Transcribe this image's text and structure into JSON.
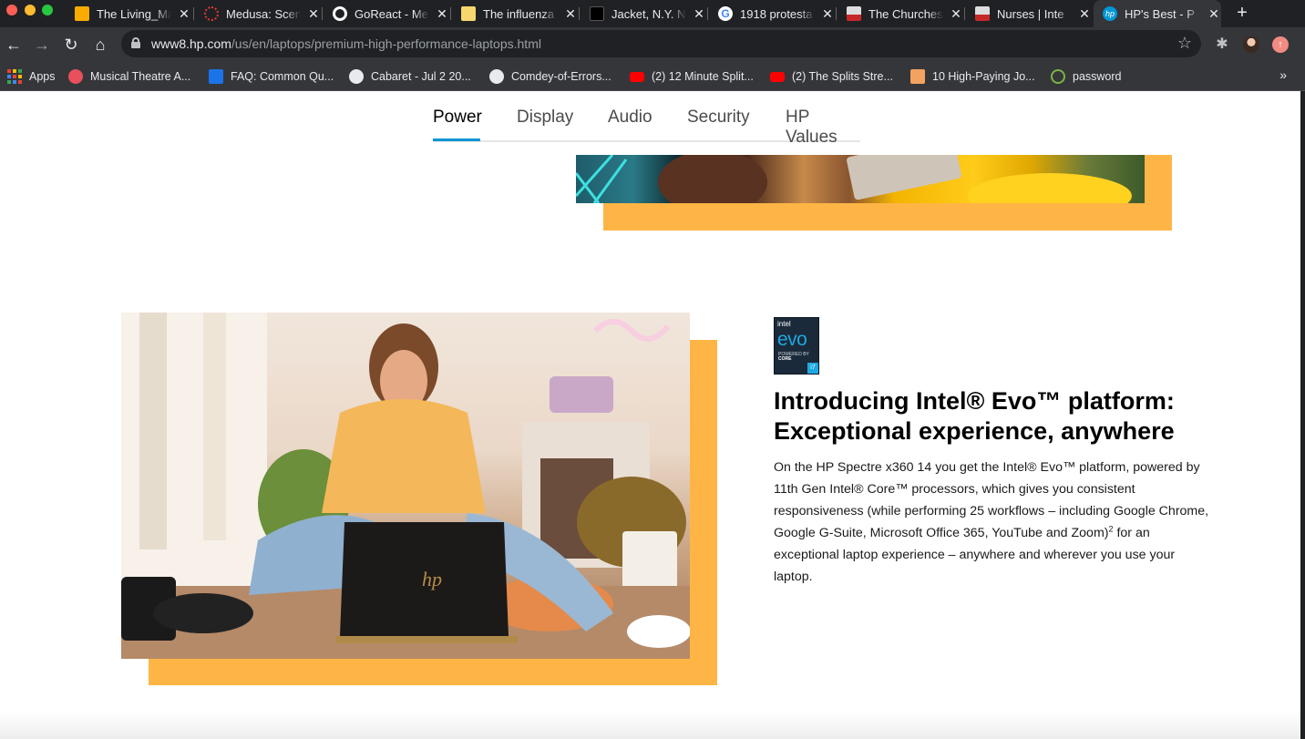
{
  "browser": {
    "tabs": [
      {
        "title": "The Living_Ma",
        "icon": "slides-icon",
        "color": "#f9ab00"
      },
      {
        "title": "Medusa: Scen",
        "icon": "medusa-icon",
        "color": "#e53935"
      },
      {
        "title": "GoReact - Me",
        "icon": "goreact-icon",
        "color": "#ffffff"
      },
      {
        "title": "The influenza",
        "icon": "influenza-icon",
        "color": "#f5d76e"
      },
      {
        "title": "Jacket, N.Y. N",
        "icon": "jacket-icon",
        "color": "#000000"
      },
      {
        "title": "1918 protesta",
        "icon": "google-icon",
        "color": "#4285f4"
      },
      {
        "title": "The Churches",
        "icon": "churches-icon",
        "color": "#c62828"
      },
      {
        "title": "Nurses | Inte",
        "icon": "nurses-icon",
        "color": "#c62828"
      },
      {
        "title": "HP's Best - P",
        "icon": "hp-icon",
        "color": "#0096d6",
        "active": true
      }
    ],
    "new_tab_label": "+",
    "url_host": "www8.hp.com",
    "url_path": "/us/en/laptops/premium-high-performance-laptops.html",
    "bookmarks": [
      {
        "label": "Apps",
        "icon": "apps-grid-icon"
      },
      {
        "label": "Musical Theatre A...",
        "icon": "musical-theatre-icon",
        "color": "#e8505b"
      },
      {
        "label": "FAQ: Common Qu...",
        "icon": "faq-icon",
        "color": "#1a73e8"
      },
      {
        "label": "Cabaret - Jul 2 20...",
        "icon": "globe-icon",
        "color": "#e8eaed"
      },
      {
        "label": "Comdey-of-Errors...",
        "icon": "globe-icon",
        "color": "#e8eaed"
      },
      {
        "label": "(2) 12 Minute Split...",
        "icon": "youtube-icon",
        "color": "#ff0000"
      },
      {
        "label": "(2) The Splits Stre...",
        "icon": "youtube-icon",
        "color": "#ff0000"
      },
      {
        "label": "10 High-Paying Jo...",
        "icon": "jobs-icon",
        "color": "#f4a261"
      },
      {
        "label": "password",
        "icon": "password-icon",
        "color": "#7cb342"
      }
    ],
    "bookmarks_overflow": "»"
  },
  "page": {
    "subnav": [
      "Power",
      "Display",
      "Audio",
      "Security",
      "HP Values"
    ],
    "subnav_active": "Power",
    "accent_color": "#ffb545",
    "link_color": "#0096d6",
    "badge": {
      "brand": "intel",
      "name": "evo",
      "tagline": "POWERED BY",
      "processor": "CORE",
      "tier": "i7"
    },
    "feature": {
      "title_line1": "Introducing Intel® Evo™ platform:",
      "title_line2": "Exceptional experience, anywhere",
      "body_before_sup": "On the HP Spectre x360 14 you get the Intel® Evo™ platform, powered by 11th Gen Intel® Core™ processors, which gives you consistent responsiveness (while performing 25 workflows – including Google Chrome, Google G-Suite, Microsoft Office 365, YouTube and Zoom)",
      "footnote": "2",
      "body_after_sup": " for an exceptional laptop experience – anywhere and wherever you use your laptop."
    }
  }
}
